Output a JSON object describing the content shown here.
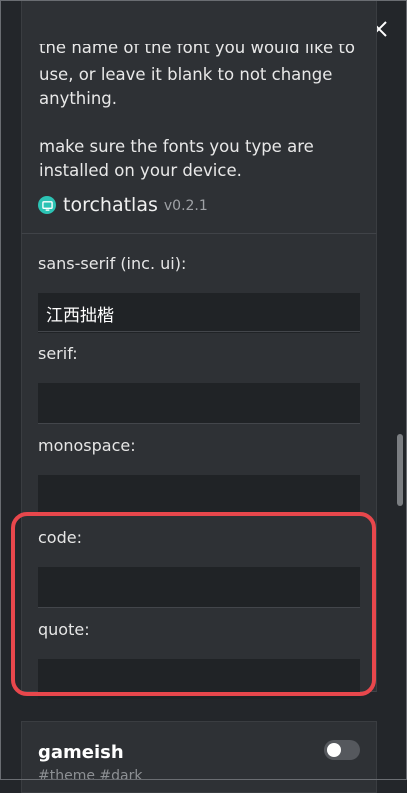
{
  "titlebar": {
    "download_icon": "download-arrow-icon",
    "minimize_icon": "minimize-icon",
    "maximize_icon": "maximize-icon",
    "close_icon": "close-icon"
  },
  "description": {
    "cut_line": "the name of the font you would like to",
    "lines": "use, or leave it blank to not change\nanything.\n\nmake sure the fonts you type are\ninstalled on your device."
  },
  "brand": {
    "name": "torchatlas",
    "version": "v0.2.1",
    "icon": "torchatlas-logo-icon",
    "color": "#2cc3b4"
  },
  "fields": {
    "sans_serif": {
      "label": "sans-serif (inc. ui):",
      "value": "江西拙楷"
    },
    "serif": {
      "label": "serif:",
      "value": ""
    },
    "monospace": {
      "label": "monospace:",
      "value": ""
    },
    "code": {
      "label": "code:",
      "value": ""
    },
    "quote": {
      "label": "quote:",
      "value": ""
    }
  },
  "highlight_color": "#e8474c",
  "theme": {
    "name": "gameish",
    "tags": "#theme #dark",
    "enabled": false
  }
}
